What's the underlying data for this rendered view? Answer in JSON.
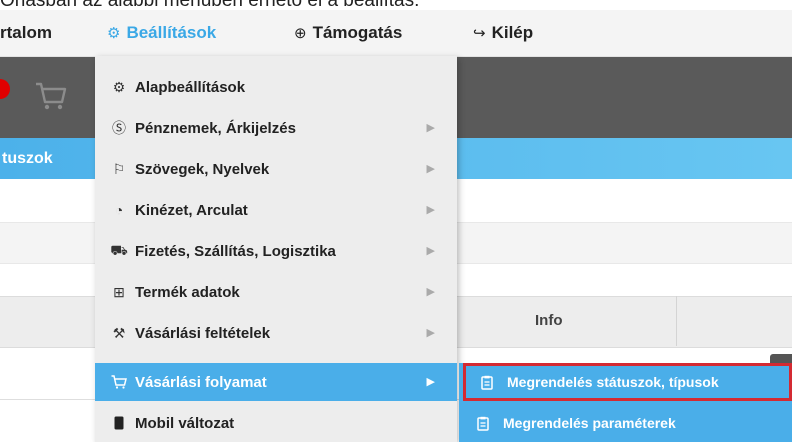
{
  "caption": "Ónásban az alábbi menüben érhető el a beállítás:",
  "topnav": {
    "items": [
      {
        "label": "rtalom",
        "icon": ""
      },
      {
        "label": "Beállítások",
        "icon": "gear-icon"
      },
      {
        "label": "Támogatás",
        "icon": "lifebuoy-icon"
      },
      {
        "label": "Kilép",
        "icon": "logout-icon"
      }
    ]
  },
  "bluebar": {
    "label": "tuszok"
  },
  "table": {
    "header_info": "Info"
  },
  "menu": {
    "items": [
      {
        "label": "Alapbeállítások",
        "icon": "gears-icon",
        "has_submenu": false
      },
      {
        "label": "Pénznemek, Árkijelzés",
        "icon": "currency-icon",
        "has_submenu": true
      },
      {
        "label": "Szövegek, Nyelvek",
        "icon": "flag-icon",
        "has_submenu": true
      },
      {
        "label": "Kinézet, Arculat",
        "icon": "palette-icon",
        "has_submenu": true
      },
      {
        "label": "Fizetés, Szállítás, Logisztika",
        "icon": "truck-icon",
        "has_submenu": true
      },
      {
        "label": "Termék adatok",
        "icon": "gift-icon",
        "has_submenu": true
      },
      {
        "label": "Vásárlási feltételek",
        "icon": "gavel-icon",
        "has_submenu": true
      },
      {
        "label": "Vásárlási folyamat",
        "icon": "cart-icon",
        "has_submenu": true,
        "active": true
      },
      {
        "label": "Mobil változat",
        "icon": "mobile-icon",
        "has_submenu": false
      }
    ]
  },
  "submenu": {
    "items": [
      {
        "label": "Megrendelés státuszok, típusok",
        "icon": "clipboard-icon",
        "highlighted": true
      },
      {
        "label": "Megrendelés paraméterek",
        "icon": "clipboard-icon",
        "highlighted": false
      }
    ]
  },
  "colors": {
    "accent": "#4aaee9",
    "highlight_border": "#d42a32",
    "dark_band": "#5a5a5a"
  }
}
